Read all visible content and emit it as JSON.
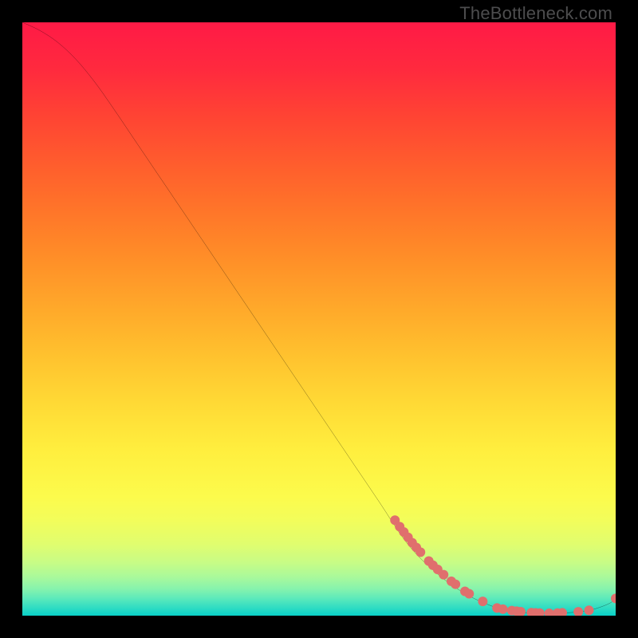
{
  "watermark": "TheBottleneck.com",
  "chart_data": {
    "type": "line",
    "title": "",
    "xlabel": "",
    "ylabel": "",
    "xlim": [
      0,
      100
    ],
    "ylim": [
      0,
      100
    ],
    "grid": false,
    "legend": false,
    "background_gradient": {
      "stops": [
        {
          "pos": 0.0,
          "color": "#ff1a46"
        },
        {
          "pos": 0.08,
          "color": "#ff2a3e"
        },
        {
          "pos": 0.16,
          "color": "#ff4433"
        },
        {
          "pos": 0.24,
          "color": "#ff5d2d"
        },
        {
          "pos": 0.32,
          "color": "#ff7629"
        },
        {
          "pos": 0.4,
          "color": "#ff8f28"
        },
        {
          "pos": 0.48,
          "color": "#ffa82a"
        },
        {
          "pos": 0.56,
          "color": "#ffc12e"
        },
        {
          "pos": 0.64,
          "color": "#ffd935"
        },
        {
          "pos": 0.72,
          "color": "#ffee3e"
        },
        {
          "pos": 0.8,
          "color": "#fcfb4c"
        },
        {
          "pos": 0.84,
          "color": "#f2fd5b"
        },
        {
          "pos": 0.88,
          "color": "#e0fd6f"
        },
        {
          "pos": 0.91,
          "color": "#c8fc85"
        },
        {
          "pos": 0.935,
          "color": "#a9f99b"
        },
        {
          "pos": 0.955,
          "color": "#86f3ad"
        },
        {
          "pos": 0.97,
          "color": "#5feaba"
        },
        {
          "pos": 0.985,
          "color": "#34dec2"
        },
        {
          "pos": 1.0,
          "color": "#09d0c7"
        }
      ]
    },
    "series": [
      {
        "name": "bottleneck-curve",
        "color": "#000000",
        "x": [
          0.0,
          3.0,
          6.0,
          9.0,
          12.0,
          15.0,
          20.0,
          25.0,
          30.0,
          35.0,
          40.0,
          45.0,
          50.0,
          55.0,
          60.0,
          65.0,
          70.0,
          75.0,
          80.0,
          83.0,
          86.0,
          89.0,
          92.0,
          95.0,
          97.0,
          99.0,
          100.0
        ],
        "y": [
          100.0,
          98.6,
          96.6,
          93.8,
          90.2,
          86.0,
          78.6,
          71.2,
          63.8,
          56.4,
          49.0,
          41.6,
          34.2,
          26.8,
          19.4,
          12.0,
          7.0,
          3.5,
          1.3,
          0.7,
          0.45,
          0.4,
          0.5,
          0.8,
          1.3,
          2.1,
          2.9
        ]
      }
    ],
    "scatter": [
      {
        "name": "highlighted-points",
        "color": "#e06f6d",
        "radius": 6,
        "points": [
          {
            "x": 62.8,
            "y": 16.1
          },
          {
            "x": 63.6,
            "y": 15.0
          },
          {
            "x": 64.3,
            "y": 14.1
          },
          {
            "x": 65.0,
            "y": 13.2
          },
          {
            "x": 65.7,
            "y": 12.3
          },
          {
            "x": 66.4,
            "y": 11.5
          },
          {
            "x": 67.1,
            "y": 10.7
          },
          {
            "x": 68.5,
            "y": 9.2
          },
          {
            "x": 69.2,
            "y": 8.5
          },
          {
            "x": 70.0,
            "y": 7.8
          },
          {
            "x": 71.0,
            "y": 6.9
          },
          {
            "x": 72.3,
            "y": 5.8
          },
          {
            "x": 73.0,
            "y": 5.3
          },
          {
            "x": 74.6,
            "y": 4.1
          },
          {
            "x": 75.3,
            "y": 3.7
          },
          {
            "x": 77.6,
            "y": 2.4
          },
          {
            "x": 80.0,
            "y": 1.3
          },
          {
            "x": 81.0,
            "y": 1.1
          },
          {
            "x": 82.5,
            "y": 0.85
          },
          {
            "x": 83.3,
            "y": 0.75
          },
          {
            "x": 84.0,
            "y": 0.68
          },
          {
            "x": 85.8,
            "y": 0.5
          },
          {
            "x": 86.5,
            "y": 0.47
          },
          {
            "x": 87.2,
            "y": 0.44
          },
          {
            "x": 88.8,
            "y": 0.41
          },
          {
            "x": 90.2,
            "y": 0.44
          },
          {
            "x": 91.0,
            "y": 0.48
          },
          {
            "x": 93.7,
            "y": 0.65
          },
          {
            "x": 95.5,
            "y": 0.9
          },
          {
            "x": 100.0,
            "y": 2.9
          }
        ]
      }
    ]
  }
}
